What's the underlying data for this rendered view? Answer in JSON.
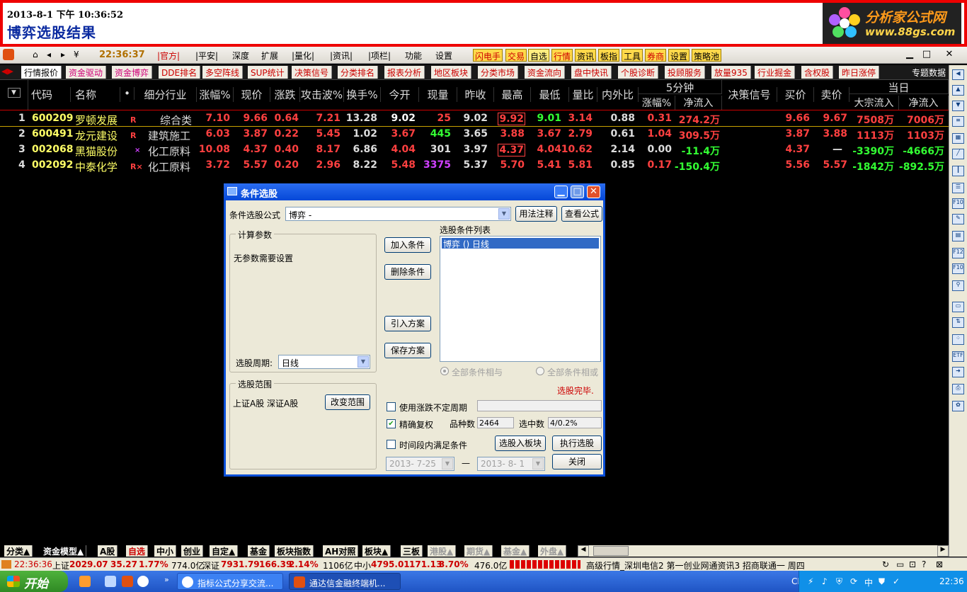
{
  "banner": {
    "datetime": "2013-8-1 下午 10:36:52",
    "title": "博弈选股结果",
    "logo_line1": "分析家公式网",
    "logo_line2": "www.88gs.com"
  },
  "toolbar": {
    "clock": "22:36:37",
    "menu": [
      "|官方|",
      "|平安|",
      "深度",
      "扩展",
      "|量化|",
      "|资讯|",
      "|项栏|",
      "功能",
      "设置"
    ],
    "buttons": [
      "闪电手",
      "交易",
      "自选",
      "行情",
      "资讯",
      "板指",
      "工具",
      "券商",
      "设置",
      "策略池"
    ]
  },
  "tabs": [
    "行情报价",
    "资金驱动",
    "资金博弈",
    "DDE排名",
    "多空阵线",
    "SUP统计",
    "决策信号",
    "分类排名",
    "报表分析",
    "地区板块",
    "分类市场",
    "资金流向",
    "盘中快讯",
    "个股诊断",
    "投顾服务",
    "放量935",
    "行业掘金",
    "含权股",
    "昨日涨停"
  ],
  "tab_special": "专题数据",
  "columns": {
    "code": "代码",
    "name": "名称",
    "dot": "•",
    "industry": "细分行业",
    "change_pct": "涨幅%",
    "price": "现价",
    "change": "涨跌",
    "wave": "攻击波%",
    "turnover": "换手%",
    "open": "今开",
    "volume": "现量",
    "prev_close": "昨收",
    "high": "最高",
    "low": "最低",
    "vol_ratio": "量比",
    "inout": "内外比",
    "five_min": "5分钟",
    "five_pct": "涨幅%",
    "five_net": "净流入",
    "signal": "决策信号",
    "bid": "买价",
    "ask": "卖价",
    "today": "当日",
    "block_in": "大宗流入",
    "net_in": "净流入"
  },
  "rows": [
    {
      "idx": "1",
      "code": "600209",
      "name": "罗顿发展",
      "flag": "R",
      "industry": "综合类",
      "change_pct": "7.10",
      "price": "9.66",
      "change": "0.64",
      "wave": "7.21",
      "turnover": "13.28",
      "open": "9.02",
      "volume": "25",
      "prev_close": "9.02",
      "high": "9.92",
      "low": "9.01",
      "vol_ratio": "3.14",
      "inout": "0.88",
      "five_pct": "0.31",
      "five_net": "274.2万",
      "bid": "9.66",
      "ask": "9.67",
      "block_in": "7508万",
      "net_in": "7006万"
    },
    {
      "idx": "2",
      "code": "600491",
      "name": "龙元建设",
      "flag": "R",
      "industry": "建筑施工",
      "change_pct": "6.03",
      "price": "3.87",
      "change": "0.22",
      "wave": "5.45",
      "turnover": "1.02",
      "open": "3.67",
      "volume": "445",
      "prev_close": "3.65",
      "high": "3.88",
      "low": "3.67",
      "vol_ratio": "2.79",
      "inout": "0.61",
      "five_pct": "1.04",
      "five_net": "309.5万",
      "bid": "3.87",
      "ask": "3.88",
      "block_in": "1113万",
      "net_in": "1103万"
    },
    {
      "idx": "3",
      "code": "002068",
      "name": "黑猫股份",
      "flag": "×",
      "industry": "化工原料",
      "change_pct": "10.08",
      "price": "4.37",
      "change": "0.40",
      "wave": "8.17",
      "turnover": "6.86",
      "open": "4.04",
      "volume": "301",
      "prev_close": "3.97",
      "high": "4.37",
      "low": "4.04",
      "vol_ratio": "10.62",
      "inout": "2.14",
      "five_pct": "0.00",
      "five_net": "-11.4万",
      "bid": "4.37",
      "ask": "—",
      "block_in": "-3390万",
      "net_in": "-4666万"
    },
    {
      "idx": "4",
      "code": "002092",
      "name": "中泰化学",
      "flag": "R×",
      "industry": "化工原料",
      "change_pct": "3.72",
      "price": "5.57",
      "change": "0.20",
      "wave": "2.96",
      "turnover": "8.22",
      "open": "5.48",
      "volume": "3375",
      "prev_close": "5.37",
      "high": "5.70",
      "low": "5.41",
      "vol_ratio": "5.81",
      "inout": "0.85",
      "five_pct": "0.17",
      "five_net": "-150.4万",
      "bid": "5.56",
      "ask": "5.57",
      "block_in": "-1842万",
      "net_in": "-892.5万"
    }
  ],
  "dialog": {
    "title": "条件选股",
    "formula_label": "条件选股公式",
    "formula_value": "博弈        -",
    "usage_btn": "用法注释",
    "view_btn": "查看公式",
    "params_group": "计算参数",
    "params_text": "无参数需要设置",
    "add_btn": "加入条件",
    "del_btn": "删除条件",
    "import_btn": "引入方案",
    "save_btn": "保存方案",
    "list_label": "选股条件列表",
    "list_item": "博弈  ()  日线",
    "period_label": "选股周期:",
    "period_value": "日线",
    "radio_and": "全部条件相与",
    "radio_or": "全部条件相或",
    "done_text": "选股完毕.",
    "range_group": "选股范围",
    "range_text": "上证A股 深证A股",
    "change_range_btn": "改变范围",
    "use_period": "使用涨跌不定周期",
    "exact_adjust": "精确复权",
    "count_label": "品种数",
    "count_value": "2464",
    "selected_label": "选中数",
    "selected_value": "4/0.2%",
    "time_cond": "时间段内满足条件",
    "to_block_btn": "选股入板块",
    "run_btn": "执行选股",
    "date_from": "2013- 7-25",
    "date_dash": "—",
    "date_to": "2013- 8- 1",
    "close_btn": "关闭"
  },
  "bottom_tabs": [
    "分类▲",
    "资金模型▲",
    "A股",
    "自选",
    "中小",
    "创业",
    "自定▲",
    "基金",
    "板块指数",
    "AH对照",
    "板块▲",
    "三板",
    "港股▲",
    "期货▲",
    "基金▲",
    "外盘▲"
  ],
  "status": {
    "time": "22:36:36",
    "sh_label": "上证",
    "sh_value": "2029.07",
    "sh_chg": "35.27",
    "sh_pct": "1.77%",
    "sh_amt": "774.0亿",
    "sz_label": "深证",
    "sz_value": "7931.79",
    "sz_chg": "166.39",
    "sz_pct": "2.14%",
    "sz_amt": "1106亿",
    "zx_label": "中小",
    "zx_value": "4795.01",
    "zx_chg": "171.13",
    "zx_pct": "3.70%",
    "zx_amt": "476.0亿",
    "info": "高级行情_深圳电信2  第一创业网通资讯3  招商联通一   周四"
  },
  "taskbar": {
    "start": "开始",
    "task1": "指标公式分享交流...",
    "task2": "通达信金融终端机...",
    "lang": "CH",
    "time": "22:36"
  }
}
